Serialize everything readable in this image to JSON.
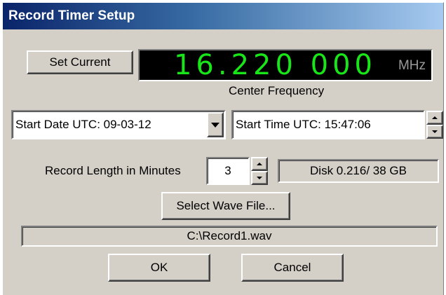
{
  "window": {
    "title": "Record Timer Setup"
  },
  "buttons": {
    "set_current": "Set Current",
    "select_wave": "Select Wave File...",
    "ok": "OK",
    "cancel": "Cancel"
  },
  "frequency": {
    "value": "16.220 000",
    "unit": "MHz",
    "caption": "Center Frequency"
  },
  "start_date": {
    "value": "Start Date UTC: 09-03-12"
  },
  "start_time": {
    "value": "Start Time UTC: 15:47:06"
  },
  "record_length": {
    "label": "Record Length in Minutes",
    "value": "3"
  },
  "disk": {
    "text": "Disk 0.216/ 38 GB"
  },
  "wave_file": {
    "path": "C:\\Record1.wav"
  },
  "colors": {
    "dialog_bg": "#d4d0c8",
    "title_bar_start": "#0a246a",
    "title_bar_end": "#a6caf0",
    "display_bg": "#000000",
    "display_digits": "#19e619",
    "display_unit": "#9a9a9a"
  },
  "icons": {
    "combo_arrow": "chevron-down-icon",
    "spin_up": "spin-up-icon",
    "spin_down": "spin-down-icon"
  }
}
